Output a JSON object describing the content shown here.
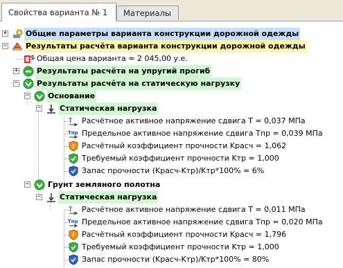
{
  "tabs": [
    {
      "label": "Свойства варианта № 1",
      "active": true
    },
    {
      "label": "Материалы",
      "active": false
    }
  ],
  "tree": {
    "general": {
      "label": "Общие параметры варианта конструкции дорожной одежды",
      "expander": "+"
    },
    "results": {
      "label": "Результаты расчёта варианта конструкции дорожной одежды",
      "expander": "−"
    },
    "price": {
      "label": "Общая цена варианта = 2 045,00 у.е."
    },
    "elastic": {
      "label": "Результаты расчёта на упругий прогиб",
      "expander": "+"
    },
    "static": {
      "label": "Результаты расчёта на статическую нагрузку",
      "expander": "−"
    },
    "base": {
      "label": "Основание",
      "expander": "−",
      "load": {
        "label": "Статическая нагрузка",
        "expander": "−"
      },
      "items": [
        "Расчётное активное напряжение сдвига T = 0,037 МПа",
        "Предельное активное напряжение сдвига Tпр = 0,039 МПа",
        "Расчётный коэффициент прочности Kрасч = 1,062",
        "Требуемый коэффициент прочности Kтр = 1,000",
        "Запас прочности (Kрасч-Kтр)/Kтр*100% = 6%"
      ]
    },
    "soil": {
      "label": "Грунт земляного полотна",
      "expander": "−",
      "load": {
        "label": "Статическая нагрузка",
        "expander": "−"
      },
      "items": [
        "Расчётное активное напряжение сдвига T = 0,011 МПа",
        "Предельное активное напряжение сдвига Tпр = 0,020 МПа",
        "Расчётный коэффициент прочности Kрасч = 1,796",
        "Требуемый коэффициент прочности Kтр = 1,000",
        "Запас прочности (Kрасч-Kтр)/Kтр*100% = 80%"
      ]
    }
  },
  "colors": {
    "blue_hl": "#c6defa",
    "yellow_hl": "#fff3b3",
    "green_hl": "#d2f5d2"
  }
}
